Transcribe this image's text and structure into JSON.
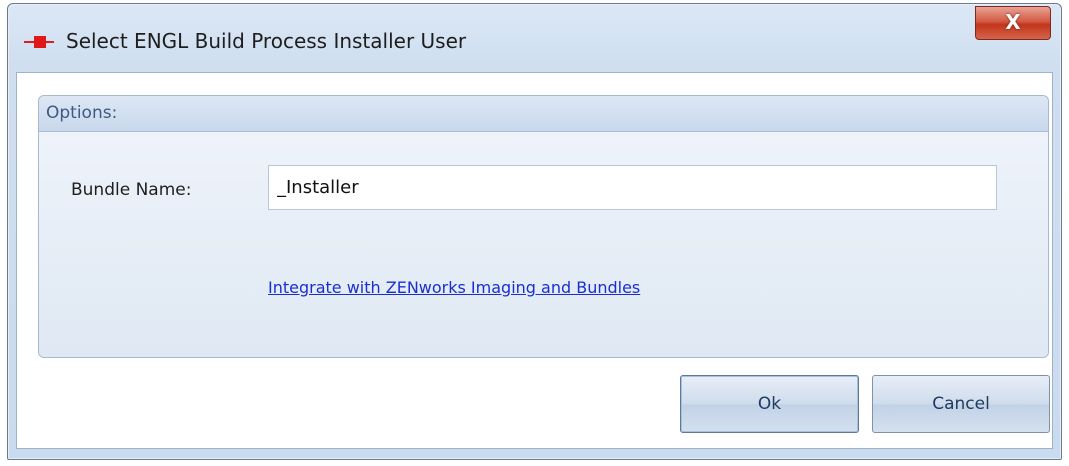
{
  "window": {
    "title": "Select ENGL Build Process Installer User",
    "close_glyph": "X",
    "icon": "app-red-square-icon"
  },
  "options_group": {
    "title": "Options:",
    "bundle_name_label": "Bundle Name:",
    "bundle_name_value": "_Installer",
    "link_text": "Integrate with ZENworks Imaging and Bundles"
  },
  "buttons": {
    "ok_label": "Ok",
    "cancel_label": "Cancel"
  },
  "colors": {
    "close_button": "#c2351c",
    "link": "#1a2fd0",
    "group_title": "#3e5a82",
    "app_icon": "#e01818"
  }
}
